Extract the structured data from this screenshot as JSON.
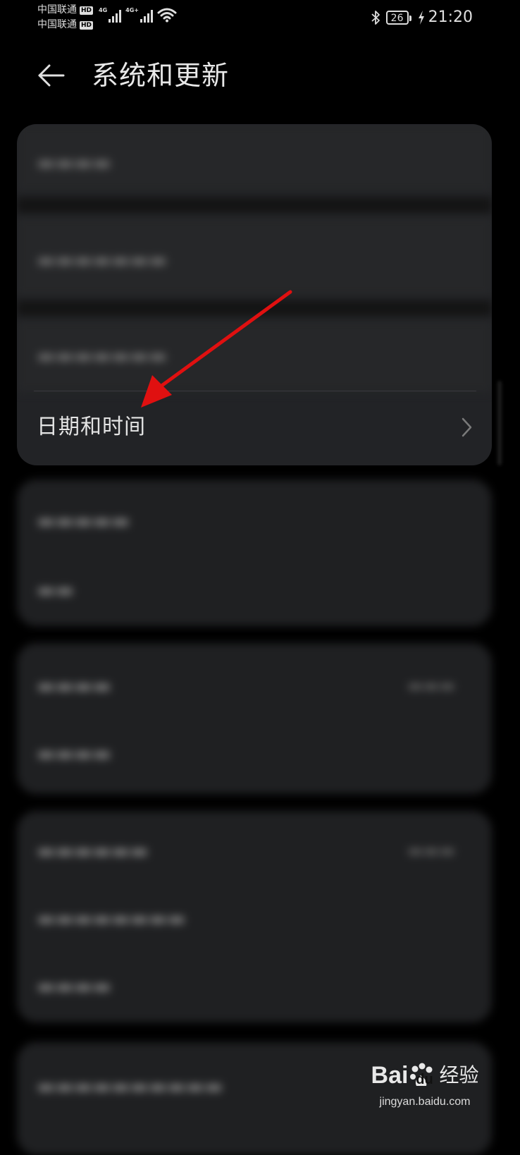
{
  "status_bar": {
    "carrier_1": "中国联通",
    "carrier_2": "中国联通",
    "hd_badge": "HD",
    "network_1": "4G",
    "network_2": "4G+",
    "battery_level": "26",
    "time": "21:20",
    "icons": [
      "signal-icon",
      "wifi-icon",
      "bluetooth-icon",
      "battery-icon",
      "charging-bolt-icon"
    ]
  },
  "header": {
    "title": "系统和更新",
    "back_icon": "back-arrow-icon"
  },
  "settings": {
    "focused_item": {
      "label": "日期和时间",
      "icon": "chevron-right-icon"
    },
    "blurred_items": [
      "",
      "",
      "",
      "",
      "",
      "",
      "",
      "",
      "",
      ""
    ]
  },
  "annotation": {
    "arrow_color": "#e01010"
  },
  "watermark": {
    "brand": "Bai",
    "brand_tail": "du",
    "cn": "经验",
    "domain": "jingyan.baidu.com"
  }
}
